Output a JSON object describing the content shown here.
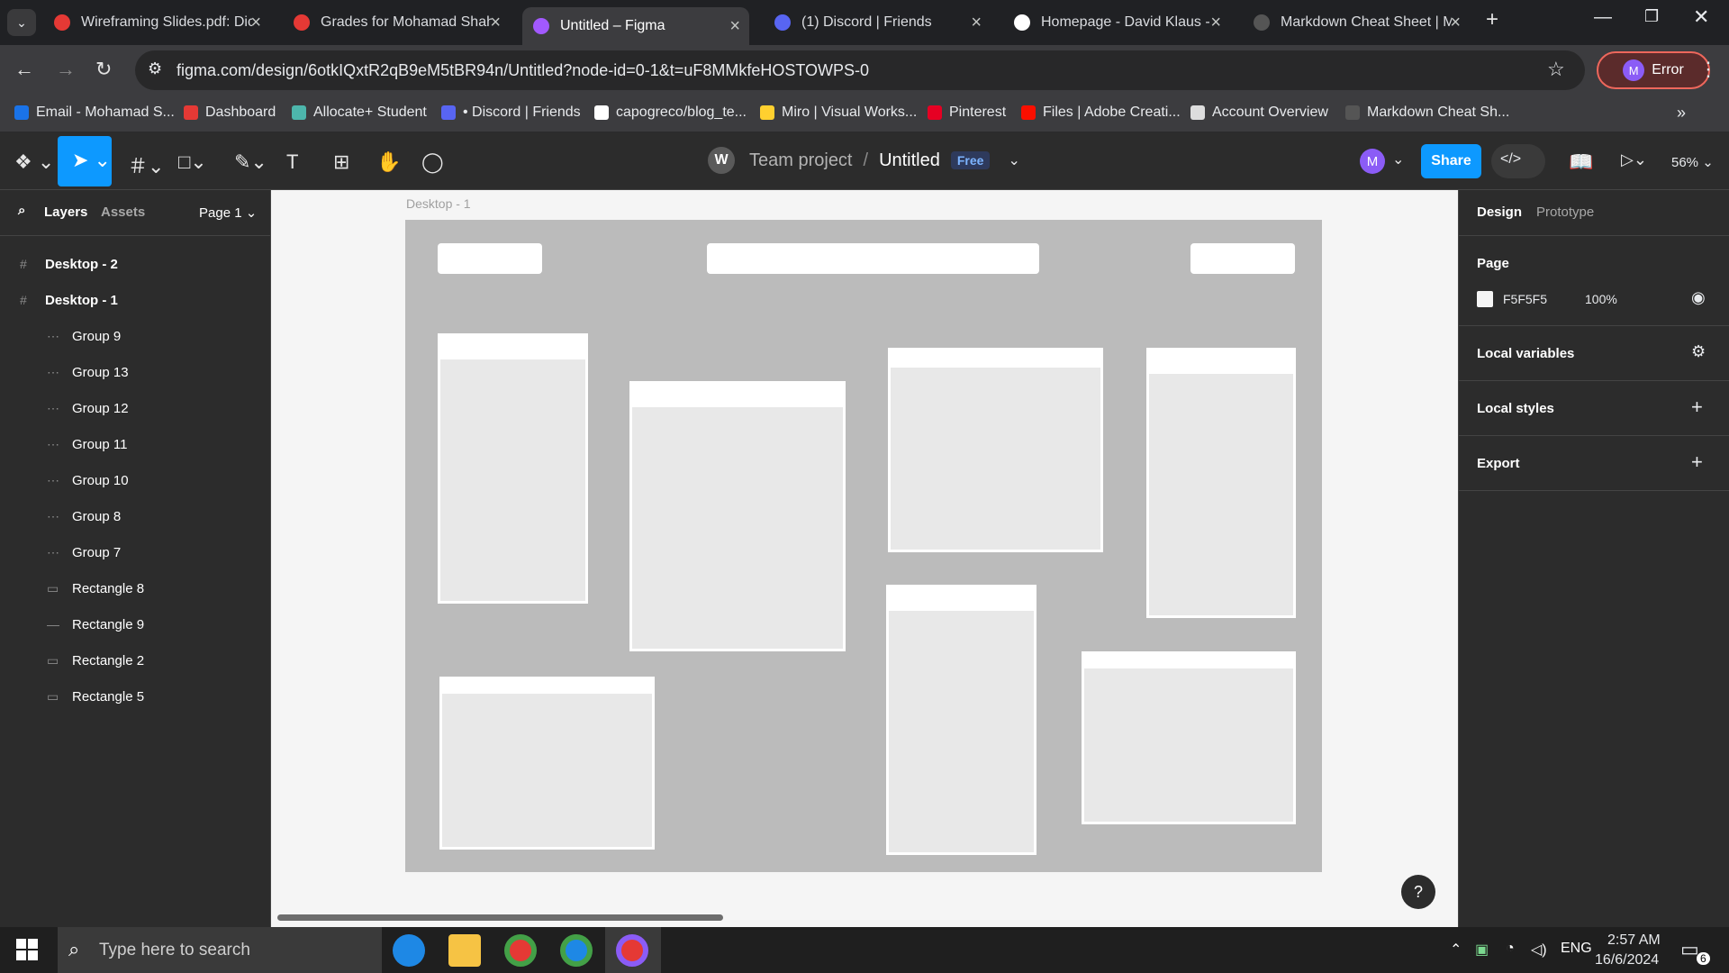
{
  "browser": {
    "tabs": [
      {
        "title": "Wireframing Slides.pdf: Dic",
        "color": "#e53935"
      },
      {
        "title": "Grades for Mohamad Shah",
        "color": "#e53935"
      },
      {
        "title": "Untitled – Figma",
        "color": "#a259ff",
        "active": true
      },
      {
        "title": "(1) Discord | Friends",
        "color": "#5865f2"
      },
      {
        "title": "Homepage - David Klaus -",
        "color": "#ffffff"
      },
      {
        "title": "Markdown Cheat Sheet | M",
        "color": "#555555"
      }
    ],
    "url": "figma.com/design/6otkIQxtR2qB9eM5tBR94n/Untitled?node-id=0-1&t=uF8MMkfeHOSTOWPS-0",
    "profile_label": "Error",
    "profile_initial": "M",
    "bookmarks": [
      {
        "label": "Email - Mohamad S...",
        "color": "#1a73e8"
      },
      {
        "label": "Dashboard",
        "color": "#e53935"
      },
      {
        "label": "Allocate+ Student",
        "color": "#4db6ac"
      },
      {
        "label": "• Discord | Friends",
        "color": "#5865f2"
      },
      {
        "label": "capogreco/blog_te...",
        "color": "#ffffff"
      },
      {
        "label": "Miro | Visual Works...",
        "color": "#ffd02f"
      },
      {
        "label": "Pinterest",
        "color": "#e60023"
      },
      {
        "label": "Files | Adobe Creati...",
        "color": "#fa0f00"
      },
      {
        "label": "Account Overview",
        "color": "#dddddd"
      },
      {
        "label": "Markdown Cheat Sh...",
        "color": "#555555"
      }
    ]
  },
  "figma": {
    "workspace_initial": "W",
    "project": "Team project",
    "separator": "/",
    "file_name": "Untitled",
    "plan_badge": "Free",
    "user_initial": "M",
    "share_label": "Share",
    "zoom": "56%",
    "left_tabs": {
      "layers": "Layers",
      "assets": "Assets",
      "page": "Page 1"
    },
    "layers": [
      {
        "name": "Desktop - 2",
        "kind": "frame"
      },
      {
        "name": "Desktop - 1",
        "kind": "frame"
      },
      {
        "name": "Group 9",
        "kind": "group"
      },
      {
        "name": "Group 13",
        "kind": "group"
      },
      {
        "name": "Group 12",
        "kind": "group"
      },
      {
        "name": "Group 11",
        "kind": "group"
      },
      {
        "name": "Group 10",
        "kind": "group"
      },
      {
        "name": "Group 8",
        "kind": "group"
      },
      {
        "name": "Group 7",
        "kind": "group"
      },
      {
        "name": "Rectangle 8",
        "kind": "rect"
      },
      {
        "name": "Rectangle 9",
        "kind": "line"
      },
      {
        "name": "Rectangle 2",
        "kind": "rect"
      },
      {
        "name": "Rectangle 5",
        "kind": "rect"
      }
    ],
    "frame_label": "Desktop - 1",
    "right_tabs": {
      "design": "Design",
      "prototype": "Prototype"
    },
    "page_section": "Page",
    "page_color": "F5F5F5",
    "page_opacity": "100%",
    "local_variables": "Local variables",
    "local_styles": "Local styles",
    "export": "Export",
    "help": "?"
  },
  "taskbar": {
    "search_placeholder": "Type here to search",
    "language": "ENG",
    "time": "2:57 AM",
    "date": "16/6/2024",
    "notifications": "6"
  },
  "colors": {
    "accent": "#0d99ff",
    "canvas": "#f5f5f5",
    "frame": "#bbbbbb"
  }
}
